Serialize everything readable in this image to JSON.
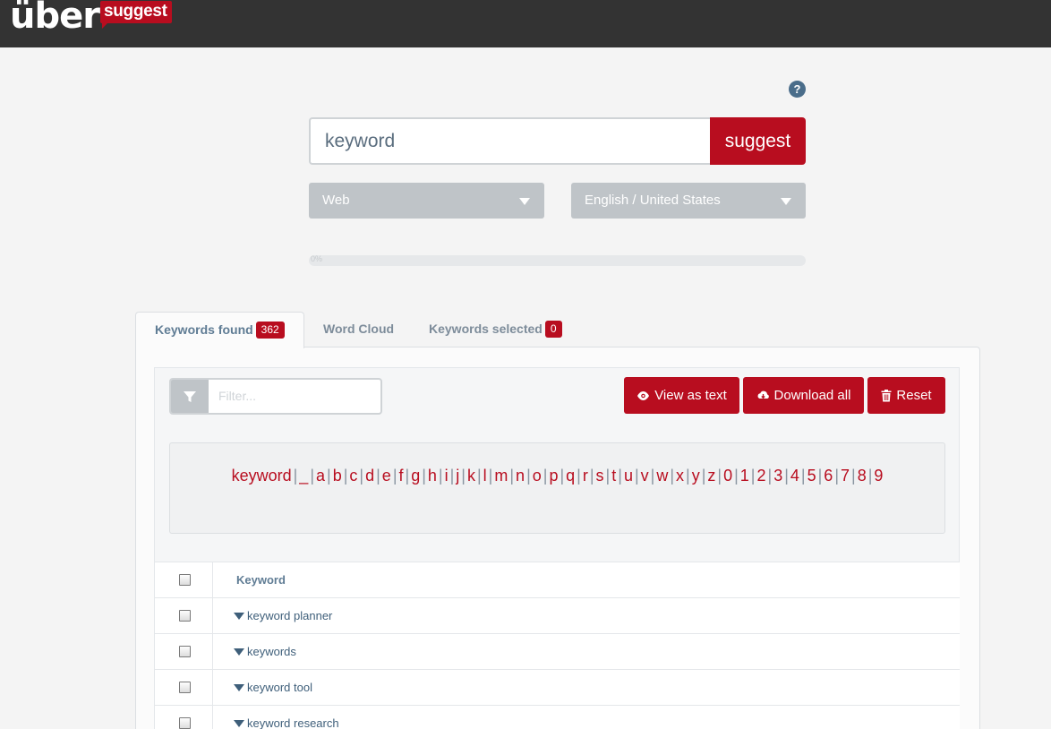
{
  "header": {
    "logo_main": "über",
    "logo_sub": "suggest"
  },
  "help": {
    "label": "?"
  },
  "search": {
    "query": "keyword",
    "button_label": "suggest"
  },
  "selects": {
    "source": "Web",
    "language": "English / United States"
  },
  "progress": {
    "percent_label": "0%",
    "value": 0
  },
  "tabs": [
    {
      "label": "Keywords found",
      "count": "362"
    },
    {
      "label": "Word Cloud"
    },
    {
      "label": "Keywords selected",
      "count": "0"
    }
  ],
  "filter": {
    "placeholder": "Filter..."
  },
  "actions": {
    "view_as_text": "View as text",
    "download_all": "Download all",
    "reset": "Reset"
  },
  "alphabet": [
    "keyword",
    "_",
    "a",
    "b",
    "c",
    "d",
    "e",
    "f",
    "g",
    "h",
    "i",
    "j",
    "k",
    "l",
    "m",
    "n",
    "o",
    "p",
    "q",
    "r",
    "s",
    "t",
    "u",
    "v",
    "w",
    "x",
    "y",
    "z",
    "0",
    "1",
    "2",
    "3",
    "4",
    "5",
    "6",
    "7",
    "8",
    "9"
  ],
  "table": {
    "header": "Keyword",
    "rows": [
      "keyword planner",
      "keywords",
      "keyword tool",
      "keyword research"
    ]
  },
  "colors": {
    "brand_red": "#b80d1f",
    "header_bg": "#333333",
    "select_gray": "#bfc4c8"
  },
  "icons": [
    "filter-icon",
    "eye-icon",
    "cloud-download-icon",
    "trash-icon",
    "caret-down-icon",
    "help-icon"
  ]
}
